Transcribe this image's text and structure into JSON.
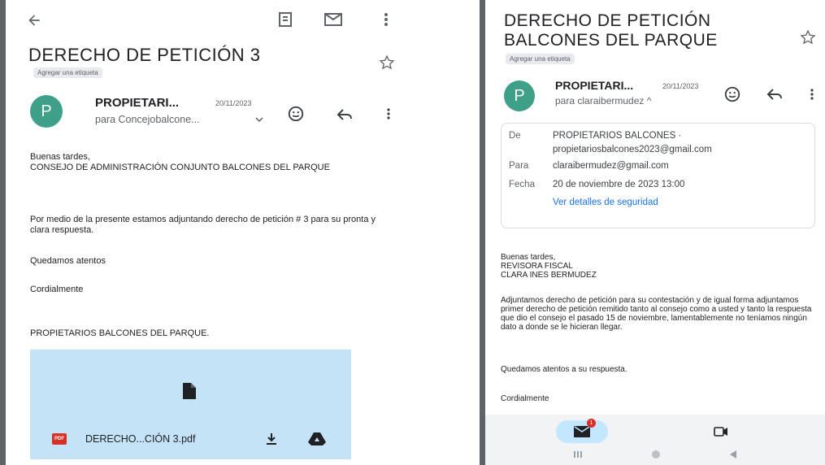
{
  "left": {
    "toolbar": {
      "back_icon": "arrow-left-icon",
      "archive_icon": "archive-icon",
      "mail_icon": "mark-unread-icon",
      "more_icon": "more-vert-icon"
    },
    "subject": "DERECHO DE PETICIÓN 3",
    "add_label": "Agregar una etiqueta",
    "avatar_letter": "P",
    "sender": "PROPIETARI...",
    "date": "20/11/2023",
    "recipient": "para Concejobalcone...",
    "body": {
      "greeting": "Buenas tardes,",
      "addressee": "CONSEJO DE ADMINISTRACIÓN CONJUNTO BALCONES DEL PARQUE",
      "paragraph": "Por medio de la presente estamos adjuntando derecho de petición # 3 para su pronta y clara respuesta.",
      "closing1": "Quedamos atentos",
      "closing2": "Cordialmente",
      "signature": "PROPIETARIOS BALCONES DEL PARQUE."
    },
    "attachment": {
      "badge": "PDF",
      "filename": "DERECHO...CIÓN 3.pdf"
    }
  },
  "right": {
    "subject_line1": "DERECHO DE PETICIÓN",
    "subject_line2": "BALCONES DEL PARQUE",
    "add_label": "Agregar una etiqueta",
    "avatar_letter": "P",
    "sender": "PROPIETARI...",
    "date": "20/11/2023",
    "recipient": "para claraibermudez ^",
    "details": {
      "de_label": "De",
      "de_value1": "PROPIETARIOS BALCONES ·",
      "de_value2": "propietariosbalcones2023@gmail.com",
      "para_label": "Para",
      "para_value": "claraibermudez@gmail.com",
      "fecha_label": "Fecha",
      "fecha_value": "20 de noviembre de 2023 13:00",
      "security_link": "Ver detalles de seguridad"
    },
    "body": {
      "greeting": "Buenas tardes,",
      "line2": "REVISORA FISCAL",
      "line3": "CLARA INES BERMUDEZ",
      "paragraph": "Adjuntamos derecho de petición para su contestación y de igual forma adjuntamos primer derecho de petición remitido tanto al consejo como a usted  y tanto la respuesta que dio el consejo el pasado 15 de noviembre, lamentablemente no teníamos ningún dato a donde se le hicieran llegar.",
      "closing1": "Quedamos atentos a su respuesta.",
      "closing2": "Cordialmente"
    },
    "bottom_nav": {
      "mail_badge": "1"
    }
  },
  "colors": {
    "avatar": "#3fa08a",
    "attachment_bg": "#c5e3f7",
    "link": "#1a73e8",
    "pdf_red": "#d93025",
    "badge_red": "#d93025",
    "nav_pill": "#c2e7ff"
  }
}
